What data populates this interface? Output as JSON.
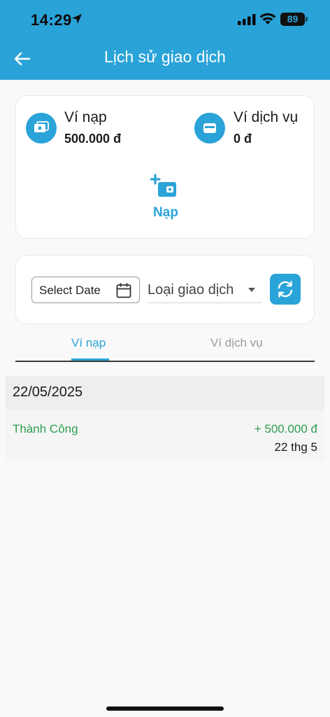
{
  "status_bar": {
    "time": "14:29",
    "battery": "89"
  },
  "header": {
    "title": "Lịch sử giao dịch"
  },
  "wallets": {
    "deposit": {
      "name": "Ví nạp",
      "amount": "500.000 đ"
    },
    "service": {
      "name": "Ví dịch vụ",
      "amount": "0 đ"
    },
    "topup_label": "Nạp"
  },
  "filters": {
    "date_label": "Select Date",
    "type_label": "Loại giao dịch"
  },
  "tabs": [
    {
      "label": "Ví nạp",
      "active": true
    },
    {
      "label": "Ví dịch vụ",
      "active": false
    }
  ],
  "transactions": {
    "date_header": "22/05/2025",
    "items": [
      {
        "status": "Thành Công",
        "amount": "+ 500.000 đ",
        "date": "22 thg 5"
      }
    ]
  },
  "colors": {
    "accent": "#2aa3d8",
    "success": "#2e9e4f"
  }
}
